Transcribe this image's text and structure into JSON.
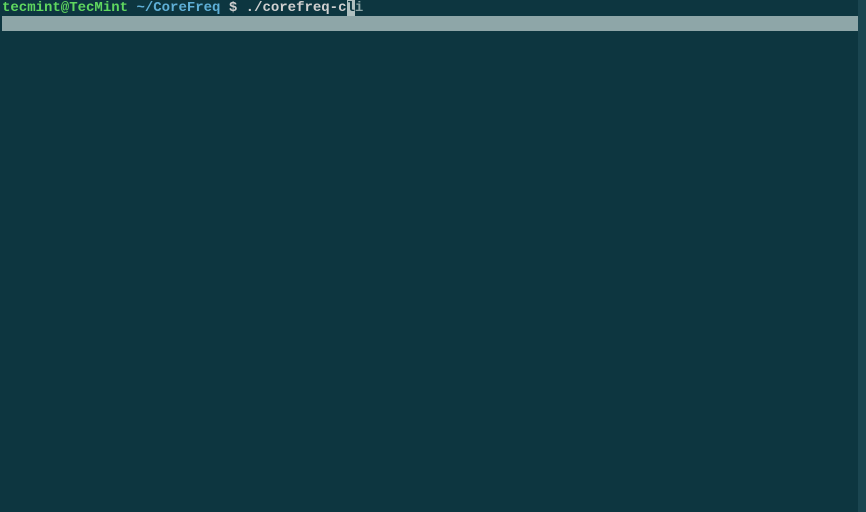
{
  "prompt": {
    "user_host": "tecmint@TecMint",
    "path": "~/CoreFreq",
    "symbol": "$",
    "typed": "./corefreq-c",
    "completion_cursor_char": "l",
    "completion_suffix": "i"
  }
}
